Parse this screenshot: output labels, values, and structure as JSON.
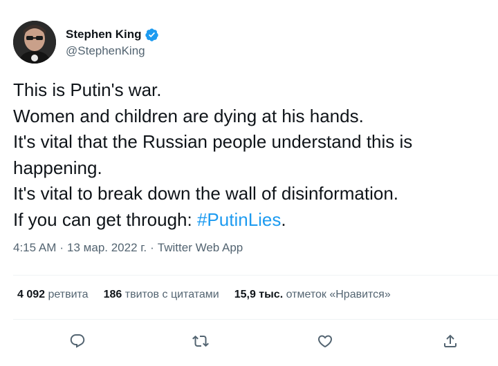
{
  "author": {
    "display_name": "Stephen King",
    "handle": "@StephenKing",
    "verified": true
  },
  "tweet": {
    "lines": [
      "This is Putin's war.",
      "Women and children are dying at his hands.",
      "It's vital that the Russian people understand this is",
      "happening.",
      "It's vital to break down the wall of disinformation.",
      "If you can get through: "
    ],
    "hashtag": "#PutinLies",
    "after_hashtag": "."
  },
  "meta": {
    "time": "4:15 AM",
    "separator": "·",
    "date": "13 мар. 2022 г.",
    "source": "Twitter Web App"
  },
  "stats": {
    "retweets_count": "4 092",
    "retweets_label": "ретвита",
    "quotes_count": "186",
    "quotes_label": "твитов с цитатами",
    "likes_count": "15,9 тыс.",
    "likes_label": "отметок «Нравится»"
  },
  "icons": {
    "reply": "reply-icon",
    "retweet": "retweet-icon",
    "like": "heart-icon",
    "share": "share-icon",
    "verified": "verified-badge-icon"
  },
  "colors": {
    "accent": "#1d9bf0",
    "icon_gray": "#536471",
    "text": "#0f1419"
  }
}
